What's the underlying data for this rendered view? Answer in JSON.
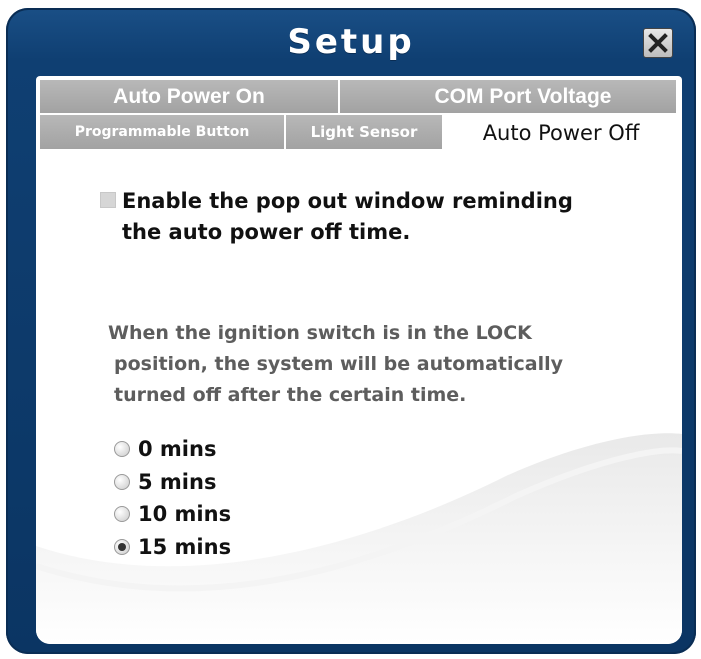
{
  "window": {
    "title": "Setup",
    "close_icon": "close-icon"
  },
  "tabs": {
    "auto_power_on": "Auto Power On",
    "com_port_voltage": "COM Port Voltage",
    "programmable_button": "Programmable Button",
    "light_sensor": "Light Sensor",
    "auto_power_off": "Auto Power Off",
    "active": "Auto Power Off"
  },
  "content": {
    "checkbox": {
      "line1": "Enable the pop out window reminding",
      "line2": "the auto power off time.",
      "checked": false
    },
    "description": {
      "line1": "When the ignition switch is in the LOCK",
      "line2": "position, the system will be automatically",
      "line3": "turned off after the certain time."
    },
    "options": [
      {
        "label": "0 mins",
        "checked": false
      },
      {
        "label": "5 mins",
        "checked": false
      },
      {
        "label": "10 mins",
        "checked": false
      },
      {
        "label": "15 mins",
        "checked": true
      }
    ]
  },
  "colors": {
    "frame_blue": "#0f3f72",
    "tab_gray": "#a8a8a8",
    "text_gray": "#5d5d5d"
  }
}
